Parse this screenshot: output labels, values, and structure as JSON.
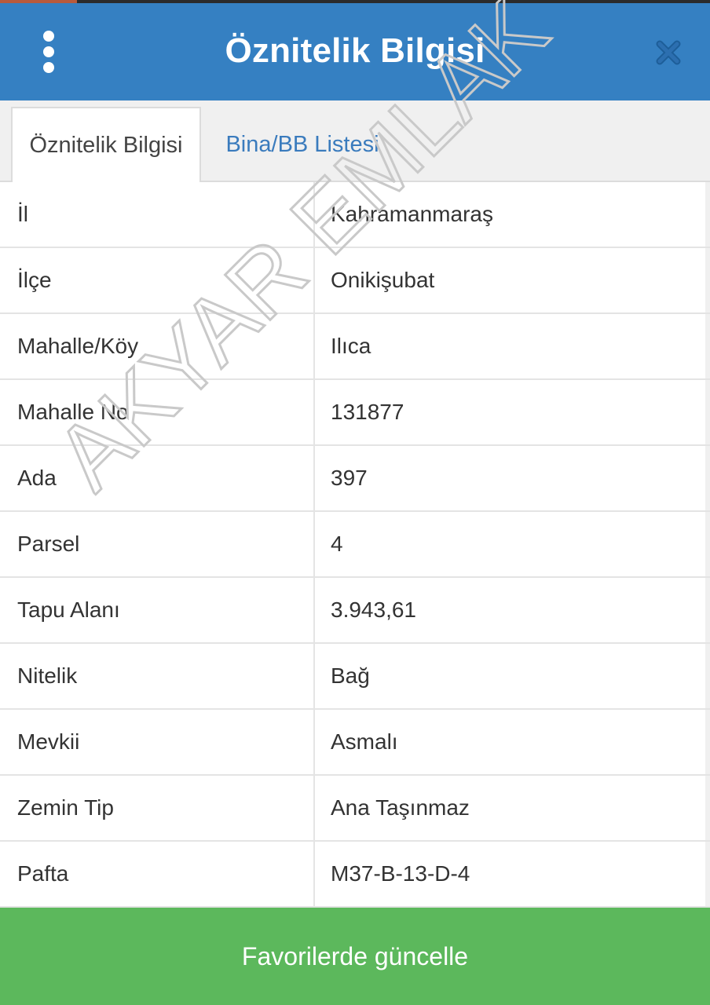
{
  "header": {
    "title": "Öznitelik Bilgisi",
    "menu_icon": "kebab-menu-icon",
    "close_icon": "close-icon",
    "color": "#3580c2"
  },
  "tabs": [
    {
      "label": "Öznitelik Bilgisi",
      "active": true
    },
    {
      "label": "Bina/BB Listesi",
      "active": false
    }
  ],
  "attributes": [
    {
      "key": "İl",
      "value": "Kahramanmaraş"
    },
    {
      "key": "İlçe",
      "value": "Onikişubat"
    },
    {
      "key": "Mahalle/Köy",
      "value": "Ilıca"
    },
    {
      "key": "Mahalle No",
      "value": "131877"
    },
    {
      "key": "Ada",
      "value": "397"
    },
    {
      "key": "Parsel",
      "value": "4"
    },
    {
      "key": "Tapu Alanı",
      "value": "3.943,61"
    },
    {
      "key": "Nitelik",
      "value": "Bağ"
    },
    {
      "key": "Mevkii",
      "value": "Asmalı"
    },
    {
      "key": "Zemin Tip",
      "value": "Ana Taşınmaz"
    },
    {
      "key": "Pafta",
      "value": "M37-B-13-D-4"
    }
  ],
  "watermark": "AKYAR EMLAK",
  "footer": {
    "button_label": "Favorilerde güncelle",
    "color": "#5cb85c"
  }
}
